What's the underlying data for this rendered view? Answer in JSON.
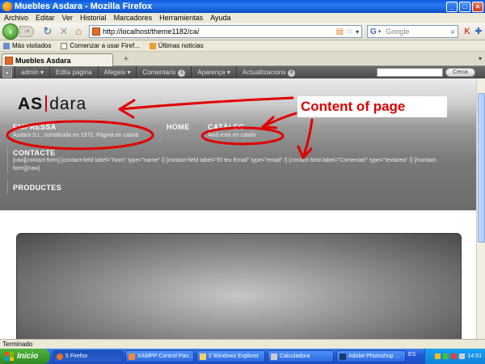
{
  "window": {
    "title": "Muebles Asdara - Mozilla Firefox"
  },
  "menu": [
    "Archivo",
    "Editar",
    "Ver",
    "Historial",
    "Marcadores",
    "Herramientas",
    "Ayuda"
  ],
  "address": {
    "url": "http://localhost/theme1182/ca/"
  },
  "search": {
    "placeholder": "Google"
  },
  "bookmarks": [
    "Más visitados",
    "Comenzar a usar Firef...",
    "Últimas noticias"
  ],
  "tab": {
    "title": "Muebles Asdara"
  },
  "adminbar": {
    "items": [
      "admin",
      "Edita pàgina",
      "Afegeix",
      "Comentaris",
      "Aparença",
      "Actualitzacions"
    ],
    "comments_count": "1",
    "updates_count": "6",
    "search_button": "Cerca"
  },
  "site": {
    "logo_left": "AS",
    "logo_right": "dara",
    "empressa_title": "EMPRESSA",
    "empressa_text": "Asdara S.L. constituida en 1972. Pàgina en català",
    "home_title": "HOME",
    "catalog_title": "CATÀLEG",
    "catalog_text": "Aixó está en català",
    "contact_title": "CONTACTE",
    "contact_text_1": "[raw][contact-form] [contact-field label=\"Nom\" type=\"name\" /] [contact-field label=\"El teu Email\" type=\"email\" /] [contact-field label=\"Comentari\" type=\"textarea\" /] [/contact-",
    "contact_text_2": "form][/raw]",
    "products_title": "PRODUCTES"
  },
  "annotation": {
    "label": "Content of page",
    "color": "#e00000"
  },
  "statusbar": {
    "text": "Terminado"
  },
  "taskbar": {
    "start": "Inicio",
    "tasks": [
      "5 Firefox",
      "XAMPP Control Pan...",
      "2 Windows Explorer",
      "Calculadora",
      "Adobe Photoshop ..."
    ],
    "lang": "ES",
    "clock": "14:51"
  }
}
